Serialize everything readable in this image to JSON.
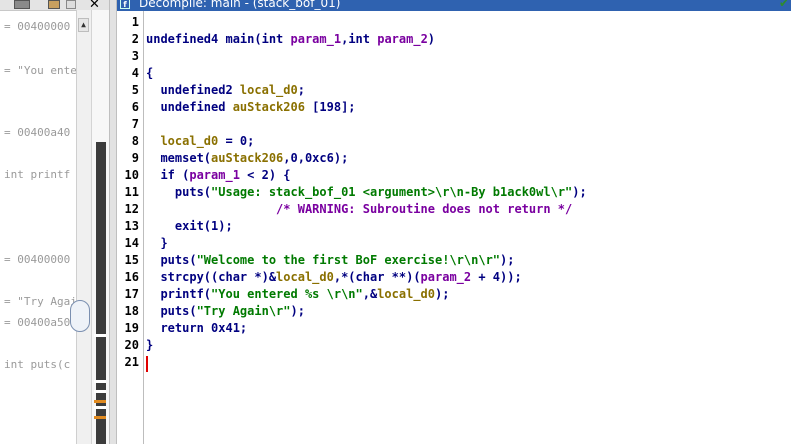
{
  "listing": {
    "lines": [
      {
        "text": "= 00400000"
      },
      {
        "text": "= \"You ente"
      },
      {
        "text": "= 00400a40"
      },
      {
        "text": "int printf"
      },
      {
        "text": "= 00400000"
      },
      {
        "text": "= \"Try Agai"
      },
      {
        "text": "= 00400a50"
      },
      {
        "text": "int puts(c"
      }
    ],
    "close_label": "✕"
  },
  "decompile": {
    "title": "Decompile: main - (stack_bof_01)",
    "lines": [
      {
        "num": "1",
        "parts": []
      },
      {
        "num": "2",
        "parts": [
          {
            "c": "t",
            "x": "undefined4 main("
          },
          {
            "c": "t",
            "x": "int "
          },
          {
            "c": "p",
            "x": "param_1"
          },
          {
            "c": "t",
            "x": ","
          },
          {
            "c": "t",
            "x": "int "
          },
          {
            "c": "p",
            "x": "param_2"
          },
          {
            "c": "t",
            "x": ")"
          }
        ]
      },
      {
        "num": "3",
        "parts": []
      },
      {
        "num": "4",
        "parts": [
          {
            "c": "t",
            "x": "{"
          }
        ]
      },
      {
        "num": "5",
        "parts": [
          {
            "c": "t",
            "x": "  undefined2 "
          },
          {
            "c": "v",
            "x": "local_d0"
          },
          {
            "c": "t",
            "x": ";"
          }
        ]
      },
      {
        "num": "6",
        "parts": [
          {
            "c": "t",
            "x": "  undefined "
          },
          {
            "c": "v",
            "x": "auStack206"
          },
          {
            "c": "t",
            "x": " [198];"
          }
        ]
      },
      {
        "num": "7",
        "parts": []
      },
      {
        "num": "8",
        "parts": [
          {
            "c": "v",
            "x": "  local_d0"
          },
          {
            "c": "t",
            "x": " = 0;"
          }
        ]
      },
      {
        "num": "9",
        "parts": [
          {
            "c": "t",
            "x": "  memset("
          },
          {
            "c": "v",
            "x": "auStack206"
          },
          {
            "c": "t",
            "x": ",0,0xc6);"
          }
        ]
      },
      {
        "num": "10",
        "parts": [
          {
            "c": "t",
            "x": "  if ("
          },
          {
            "c": "p",
            "x": "param_1"
          },
          {
            "c": "t",
            "x": " < 2) {"
          }
        ]
      },
      {
        "num": "11",
        "parts": [
          {
            "c": "t",
            "x": "    puts("
          },
          {
            "c": "s",
            "x": "\"Usage: stack_bof_01 <argument>\\r\\n-By b1ack0wl\\r\""
          },
          {
            "c": "t",
            "x": ");"
          }
        ]
      },
      {
        "num": "12",
        "parts": [
          {
            "c": "c",
            "x": "                  /* WARNING: Subroutine does not return */"
          }
        ]
      },
      {
        "num": "13",
        "parts": [
          {
            "c": "t",
            "x": "    exit(1);"
          }
        ]
      },
      {
        "num": "14",
        "parts": [
          {
            "c": "t",
            "x": "  }"
          }
        ]
      },
      {
        "num": "15",
        "parts": [
          {
            "c": "t",
            "x": "  puts("
          },
          {
            "c": "s",
            "x": "\"Welcome to the first BoF exercise!\\r\\n\\r\""
          },
          {
            "c": "t",
            "x": ");"
          }
        ]
      },
      {
        "num": "16",
        "parts": [
          {
            "c": "t",
            "x": "  strcpy((char *)&"
          },
          {
            "c": "v",
            "x": "local_d0"
          },
          {
            "c": "t",
            "x": ",*(char **)("
          },
          {
            "c": "p",
            "x": "param_2"
          },
          {
            "c": "t",
            "x": " + 4));"
          }
        ]
      },
      {
        "num": "17",
        "parts": [
          {
            "c": "t",
            "x": "  printf("
          },
          {
            "c": "s",
            "x": "\"You entered %s \\r\\n\""
          },
          {
            "c": "t",
            "x": ",&"
          },
          {
            "c": "v",
            "x": "local_d0"
          },
          {
            "c": "t",
            "x": ");"
          }
        ]
      },
      {
        "num": "18",
        "parts": [
          {
            "c": "t",
            "x": "  puts("
          },
          {
            "c": "s",
            "x": "\"Try Again\\r\""
          },
          {
            "c": "t",
            "x": ");"
          }
        ]
      },
      {
        "num": "19",
        "parts": [
          {
            "c": "t",
            "x": "  return 0x41;"
          }
        ]
      },
      {
        "num": "20",
        "parts": [
          {
            "c": "t",
            "x": "}"
          }
        ]
      },
      {
        "num": "21",
        "parts": []
      }
    ]
  },
  "colors": {
    "title_bar": "#2f62b0",
    "keyword": "#000080",
    "variable": "#8a7000",
    "parameter": "#7a00a0",
    "string": "#007a00",
    "comment": "#7a00a0"
  },
  "icons": [
    "camera-icon",
    "copy-icon",
    "dropdown-icon",
    "close-icon",
    "decompile-icon",
    "checkmark-icon"
  ]
}
